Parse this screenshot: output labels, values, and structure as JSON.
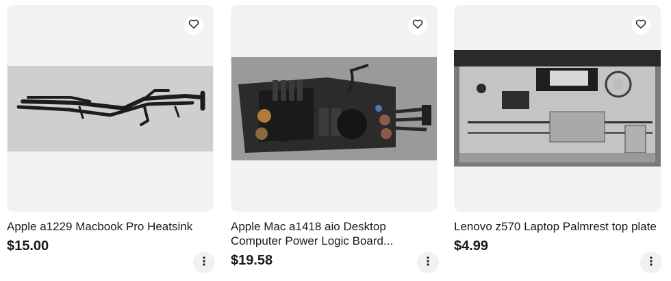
{
  "listings": [
    {
      "title": "Apple a1229 Macbook Pro Heatsink",
      "price": "$15.00",
      "image": "heatsink-photo",
      "watch_icon": "heart-icon",
      "menu_icon": "more-vert-icon"
    },
    {
      "title": "Apple Mac a1418 aio Desktop Computer Power Logic Board...",
      "price": "$19.58",
      "image": "power-board-photo",
      "watch_icon": "heart-icon",
      "menu_icon": "more-vert-icon"
    },
    {
      "title": "Lenovo z570 Laptop Palmrest top plate",
      "price": "$4.99",
      "image": "palmrest-photo",
      "watch_icon": "heart-icon",
      "menu_icon": "more-vert-icon"
    }
  ]
}
